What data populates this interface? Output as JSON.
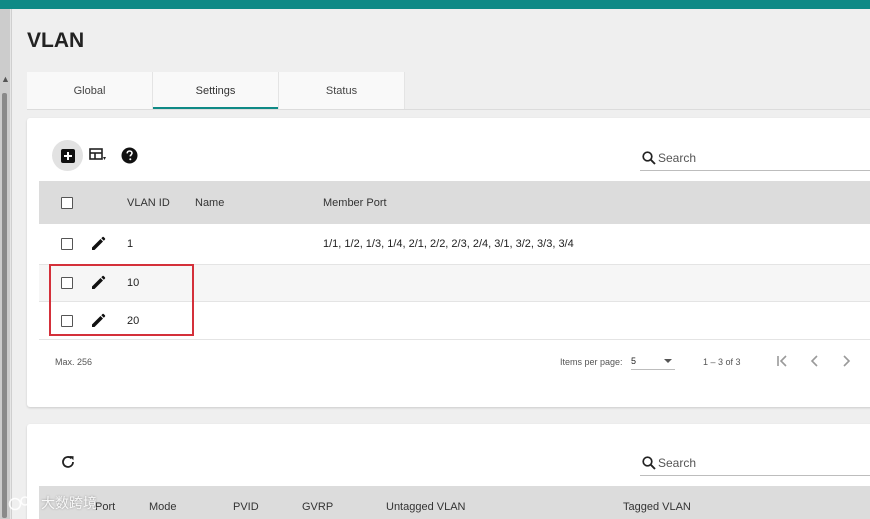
{
  "page": {
    "title": "VLAN"
  },
  "tabs": [
    {
      "label": "Global",
      "active": false
    },
    {
      "label": "Settings",
      "active": true
    },
    {
      "label": "Status",
      "active": false
    }
  ],
  "colors": {
    "accent": "#0f8a86",
    "highlight": "#d4303a"
  },
  "settings_table": {
    "icons": [
      "add-box-icon",
      "table-columns-icon",
      "help-icon",
      "search-icon",
      "edit-pencil-icon"
    ],
    "search_placeholder": "Search",
    "headers": {
      "vlan_id": "VLAN ID",
      "name": "Name",
      "member_port": "Member Port"
    },
    "rows": [
      {
        "vlan_id": "1",
        "name": "",
        "member_port": "1/1, 1/2, 1/3, 1/4, 2/1, 2/2, 2/3, 2/4, 3/1, 3/2, 3/3, 3/4"
      },
      {
        "vlan_id": "10",
        "name": "",
        "member_port": ""
      },
      {
        "vlan_id": "20",
        "name": "",
        "member_port": ""
      }
    ],
    "footer": {
      "max_text": "Max. 256",
      "items_per_page_label": "Items per page:",
      "items_per_page_value": "5",
      "range_text": "1 – 3 of 3"
    }
  },
  "status_table": {
    "icons": [
      "refresh-icon",
      "search-icon"
    ],
    "search_placeholder": "Search",
    "headers": {
      "port": "Port",
      "mode": "Mode",
      "pvid": "PVID",
      "gvrp": "GVRP",
      "untagged_vlan": "Untagged VLAN",
      "tagged_vlan": "Tagged VLAN"
    }
  },
  "watermark": {
    "text": "大数跨境"
  }
}
